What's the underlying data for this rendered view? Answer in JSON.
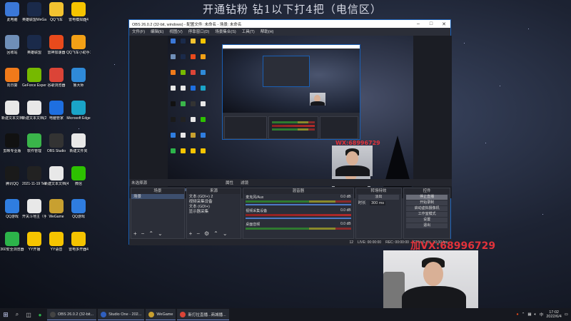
{
  "banner": "开通钻粉 钻1以下打4把（电信区）",
  "desktop_icons": [
    {
      "label": "此电脑",
      "icon": "computer-icon",
      "color": "#3b78d8"
    },
    {
      "label": "英雄联盟WeGame版",
      "icon": "lol-icon",
      "color": "#1a2a4a"
    },
    {
      "label": "QQ飞车",
      "icon": "qq-speed-icon",
      "color": "#f2c230"
    },
    {
      "label": "雷电模拟器4",
      "icon": "ldplayer-icon",
      "color": "#f5c400"
    },
    {
      "label": "回收站",
      "icon": "recycle-bin-icon",
      "color": "#6f8fb8"
    },
    {
      "label": "英雄联盟",
      "icon": "lol-icon",
      "color": "#1a2a4a"
    },
    {
      "label": "雷神加速器",
      "icon": "booster-icon",
      "color": "#e84a1c"
    },
    {
      "label": "QQ飞车小助手工具",
      "icon": "qq-tool-icon",
      "color": "#f2a016"
    },
    {
      "label": "向日葵",
      "icon": "sunflower-icon",
      "color": "#f07a1a"
    },
    {
      "label": "GeForce Experience",
      "icon": "nvidia-icon",
      "color": "#76b900"
    },
    {
      "label": "谷歌浏览器",
      "icon": "chrome-icon",
      "color": "#db4437"
    },
    {
      "label": "鲁大师",
      "icon": "ludashi-icon",
      "color": "#2f8ad8"
    },
    {
      "label": "新建文本文档",
      "icon": "text-file-icon",
      "color": "#e8e8e8"
    },
    {
      "label": "新建文本文档(2)",
      "icon": "text-file-icon",
      "color": "#e8e8e8"
    },
    {
      "label": "电脑管家",
      "icon": "pc-manager-icon",
      "color": "#1e6fe0"
    },
    {
      "label": "Microsoft Edge",
      "icon": "edge-icon",
      "color": "#1aa4c8"
    },
    {
      "label": "剪映专业版",
      "icon": "capcut-icon",
      "color": "#111111"
    },
    {
      "label": "软件管理",
      "icon": "software-icon",
      "color": "#3ab54a"
    },
    {
      "label": "OBS Studio",
      "icon": "obs-icon",
      "color": "#333333"
    },
    {
      "label": "新建文件夹",
      "icon": "text-file-icon",
      "color": "#e8e8e8"
    },
    {
      "label": "腾讯QQ",
      "icon": "qq-icon",
      "color": "#1a1a1a"
    },
    {
      "label": "2021-11-19 Team AR...",
      "icon": "capcut-icon",
      "color": "#222222"
    },
    {
      "label": "新建文本文档(4)",
      "icon": "text-file-icon",
      "color": "#e8e8e8"
    },
    {
      "label": "微信",
      "icon": "wechat-icon",
      "color": "#2dc100"
    },
    {
      "label": "QQ游戏",
      "icon": "qq-game-icon",
      "color": "#2f7de0"
    },
    {
      "label": "开关斗地主（手游电脑版）",
      "icon": "text-file-icon",
      "color": "#e8e8e8"
    },
    {
      "label": "WeGame",
      "icon": "wegame-icon",
      "color": "#c8a030"
    },
    {
      "label": "QQ游戏",
      "icon": "qq-game-icon",
      "color": "#2f7de0"
    },
    {
      "label": "360安全浏览器",
      "icon": "360-icon",
      "color": "#2cb34a"
    },
    {
      "label": "YY开播",
      "icon": "yy-icon",
      "color": "#f5c400"
    },
    {
      "label": "YY语音",
      "icon": "yy-icon",
      "color": "#f5c400"
    },
    {
      "label": "雷电多开器4",
      "icon": "ldplayer-icon",
      "color": "#f5c400"
    }
  ],
  "obs": {
    "title": "OBS 26.0.2 (32-bit, windows) - 配置文件: 未命名 - 场景: 未命名",
    "menu": [
      "文件(F)",
      "编辑(E)",
      "视图(V)",
      "停靠窗口(D)",
      "场景集合(S)",
      "工具(T)",
      "帮助(H)"
    ],
    "scene_bar": {
      "label": "未选择源",
      "props": "属性",
      "filters": "滤镜"
    },
    "docks": {
      "scenes": {
        "header": "场景",
        "items": [
          "场景"
        ]
      },
      "sources": {
        "header": "来源",
        "items": [
          "文本 (GDI+) 2",
          "视频采集设备",
          "文本 (GDI+)",
          "显示器采集"
        ]
      },
      "mixer": {
        "header": "混音器",
        "channels": [
          {
            "name": "麦克风/Aux",
            "db": "0.0 dB"
          },
          {
            "name": "视频采集设备",
            "db": "0.0 dB"
          },
          {
            "name": "桌面音频",
            "db": "0.0 dB"
          }
        ]
      },
      "transitions": {
        "header": "转场特效",
        "type": "淡出",
        "duration_label": "时长",
        "duration": "300 ms"
      },
      "controls": {
        "header": "控件",
        "buttons": [
          "停止直播",
          "开始录制",
          "启动虚拟摄像机",
          "工作室模式",
          "设置",
          "退出"
        ]
      }
    },
    "status": {
      "live": "LIVE: 00:00:00",
      "rec": "REC: 00:00:00",
      "cpu": "CPU: 5.4%, 30.00 fps",
      "dropped": "12"
    }
  },
  "watermark": {
    "small": "WX:68996729",
    "large": "加VX:68996729"
  },
  "taskbar": {
    "tasks": [
      {
        "label": "OBS 26.0.2 (32-bit...",
        "icon": "obs-icon",
        "color": "#444"
      },
      {
        "label": "Studio One - 202...",
        "icon": "studio-one-icon",
        "color": "#2f5fbf"
      },
      {
        "label": "WeGame",
        "icon": "wegame-icon",
        "color": "#c8a030"
      },
      {
        "label": "新打拉直播...商城播...",
        "icon": "chrome-icon",
        "color": "#db4437"
      }
    ],
    "time": "17:02",
    "date": "2022/6/4"
  }
}
